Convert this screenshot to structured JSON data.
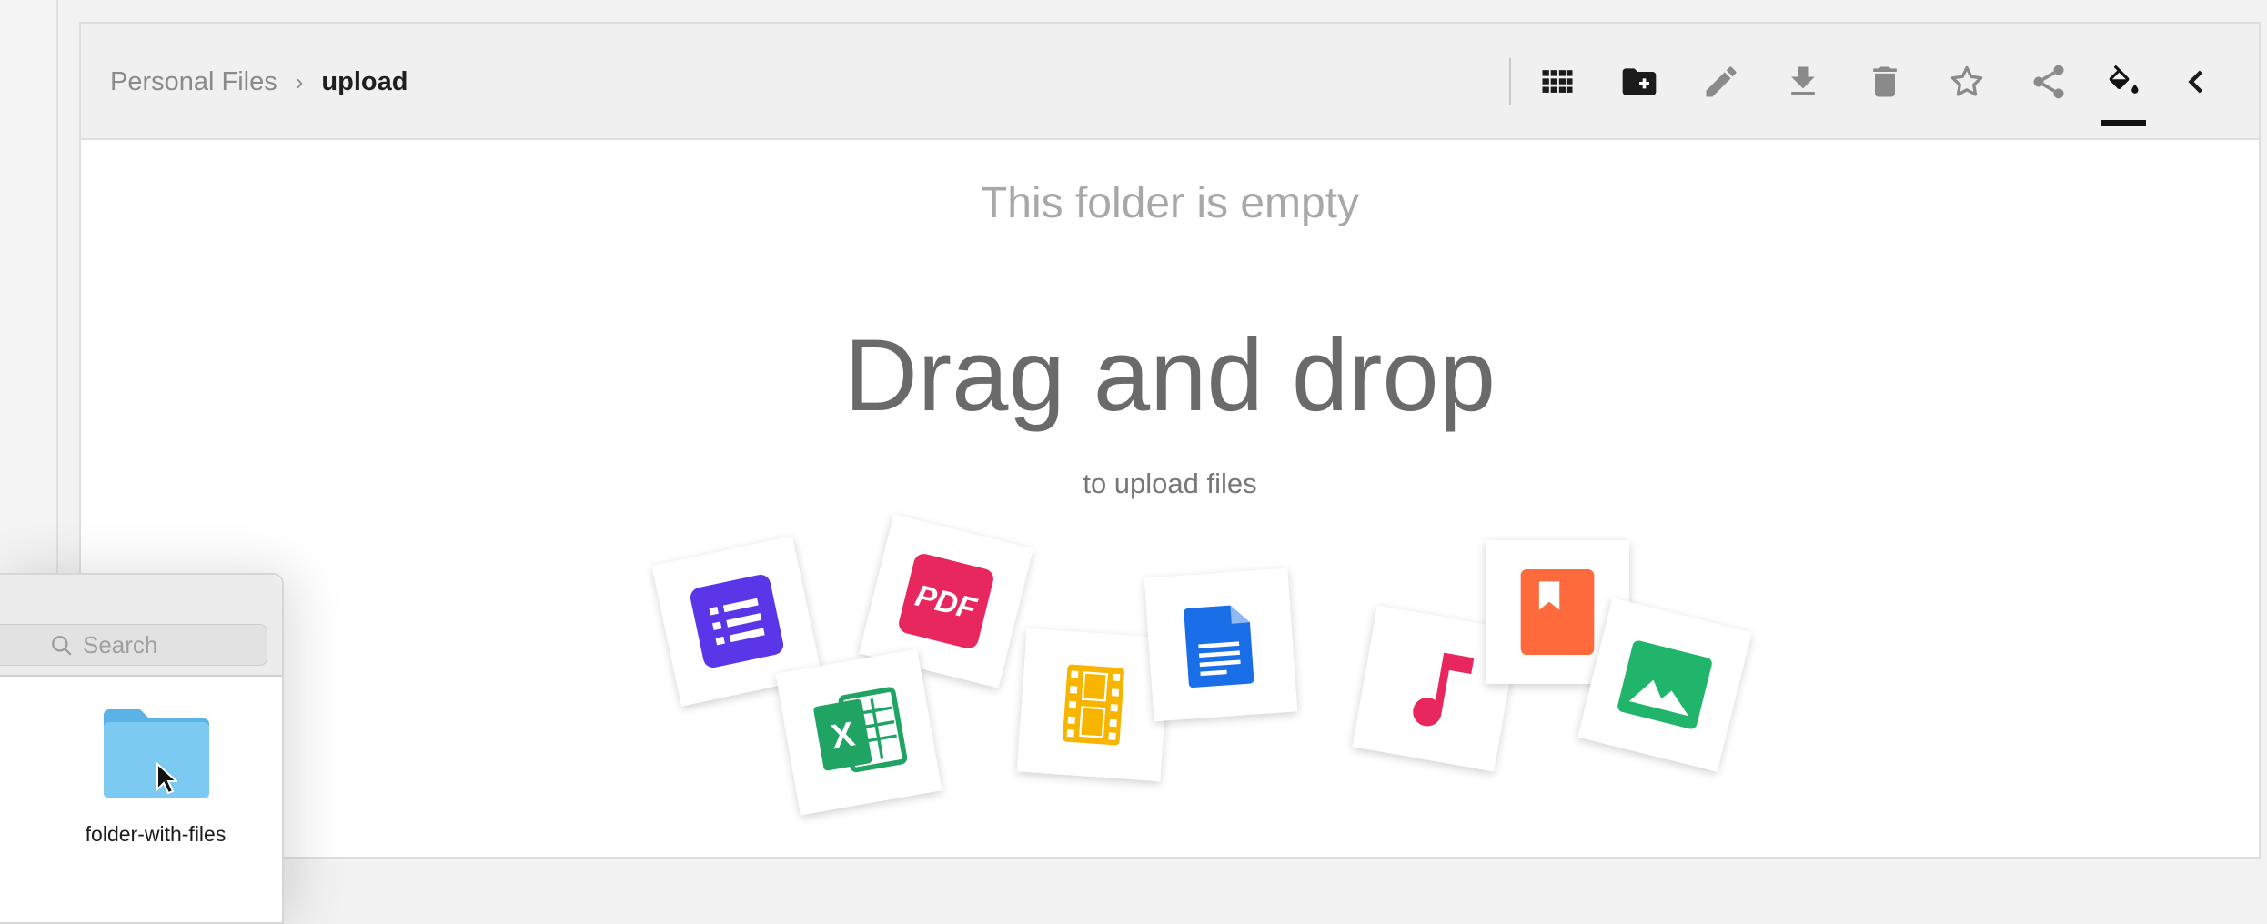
{
  "breadcrumb": {
    "parent": "Personal Files",
    "separator": "›",
    "current": "upload"
  },
  "toolbar": {
    "actions": [
      {
        "name": "grid-view",
        "icon": "grid-icon"
      },
      {
        "name": "new-folder",
        "icon": "folder-plus-icon"
      },
      {
        "name": "rename",
        "icon": "pencil-icon"
      },
      {
        "name": "download",
        "icon": "download-icon"
      },
      {
        "name": "delete",
        "icon": "trash-icon"
      },
      {
        "name": "favorite",
        "icon": "star-icon"
      },
      {
        "name": "share",
        "icon": "share-icon"
      },
      {
        "name": "theme",
        "icon": "paint-bucket-icon"
      },
      {
        "name": "collapse",
        "icon": "chevron-left-icon"
      }
    ]
  },
  "empty_state": {
    "message": "This folder is empty",
    "title": "Drag and drop",
    "subtitle": "to upload files",
    "file_types": [
      {
        "icon": "form-icon",
        "color": "#5b36e8"
      },
      {
        "icon": "pdf-icon",
        "label": "PDF",
        "color": "#e8275f"
      },
      {
        "icon": "spreadsheet-icon",
        "label": "X",
        "color": "#20a464"
      },
      {
        "icon": "video-icon",
        "color": "#f7b500"
      },
      {
        "icon": "document-icon",
        "color": "#1a6ee8"
      },
      {
        "icon": "music-icon",
        "color": "#e8275f"
      },
      {
        "icon": "ebook-icon",
        "color": "#ff6a3d"
      },
      {
        "icon": "image-icon",
        "color": "#20b56b"
      }
    ]
  },
  "finder": {
    "search_placeholder": "Search",
    "items": [
      {
        "name": "folder-with-files",
        "icon": "folder-icon",
        "color": "#6cc4f0"
      }
    ]
  }
}
